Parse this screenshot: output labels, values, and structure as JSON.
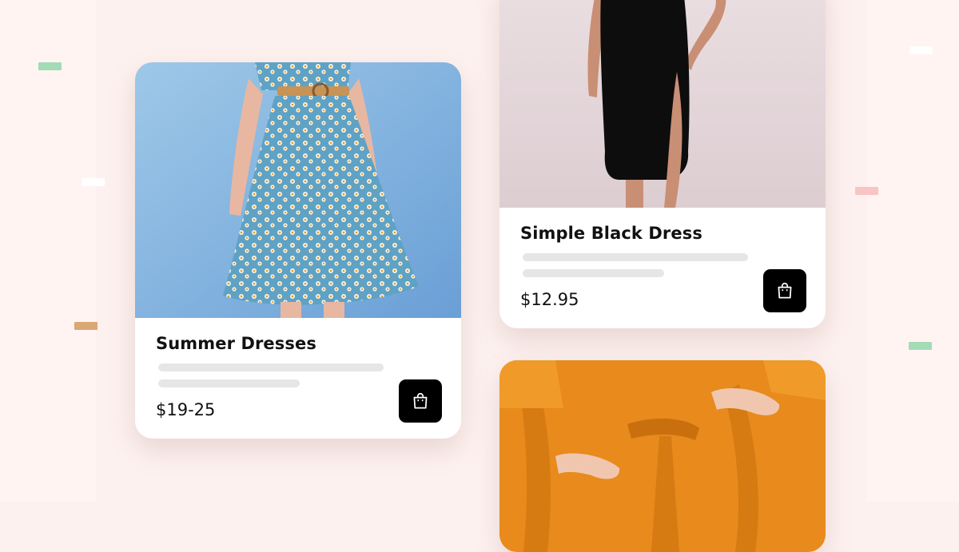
{
  "colors": {
    "background": "#fdf1ef",
    "card": "#ffffff",
    "skeleton": "#e6e6e6",
    "button": "#000000",
    "accent_green": "#a3dbb6",
    "accent_tan": "#d9a874",
    "accent_pink": "#f8c4c4"
  },
  "products": [
    {
      "title": "Summer Dresses",
      "price": "$19-25",
      "image": "blue-floral-dress-photo",
      "button_icon": "shopping-bag-icon"
    },
    {
      "title": "Simple Black Dress",
      "price": "$12.95",
      "image": "black-slit-dress-photo",
      "button_icon": "shopping-bag-icon"
    },
    {
      "title": "",
      "price": "",
      "image": "orange-wrap-dress-photo",
      "button_icon": ""
    }
  ]
}
